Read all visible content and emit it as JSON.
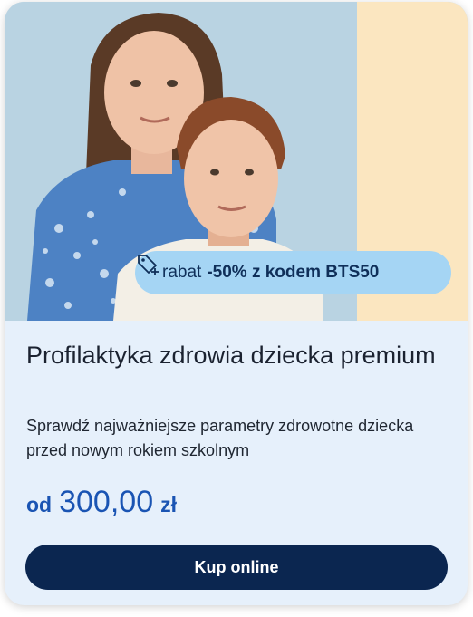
{
  "badge": {
    "icon": "tag-plus-icon",
    "word": "rabat",
    "code": "-50% z kodem BTS50"
  },
  "product": {
    "title": "Profilaktyka zdrowia dziecka premium",
    "description": "Sprawdź najważniejsze parametry zdrowotne dziecka przed nowym rokiem szkolnym",
    "price_prefix": "od",
    "price_amount": "300,00",
    "price_currency": "zł"
  },
  "cta": {
    "label": "Kup online"
  },
  "colors": {
    "accent": "#1a54b3",
    "button": "#0b2650",
    "badge": "#a5d5f4",
    "card_bg": "#e6f0fb"
  }
}
